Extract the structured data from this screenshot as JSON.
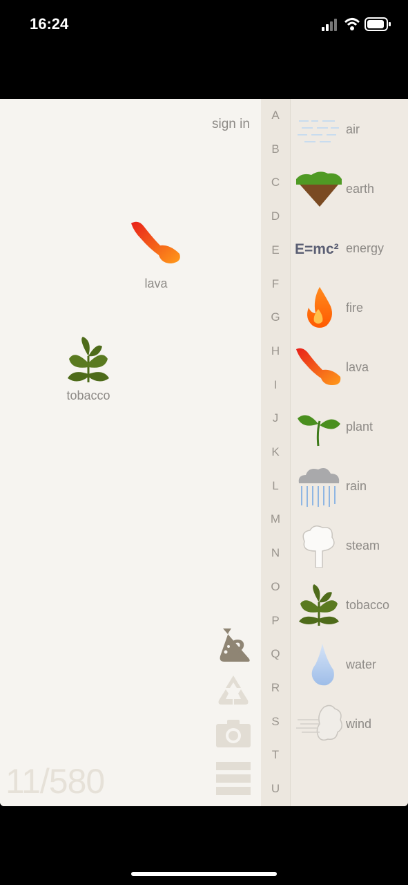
{
  "status": {
    "time": "16:24"
  },
  "workspace": {
    "sign_in": "sign in",
    "items": [
      {
        "label": "lava"
      },
      {
        "label": "tobacco"
      }
    ],
    "counter": "11/580"
  },
  "alphabet": [
    "A",
    "B",
    "C",
    "D",
    "E",
    "F",
    "G",
    "H",
    "I",
    "J",
    "K",
    "L",
    "M",
    "N",
    "O",
    "P",
    "Q",
    "R",
    "S",
    "T",
    "U"
  ],
  "elements": [
    {
      "name": "air",
      "icon": "air-icon"
    },
    {
      "name": "earth",
      "icon": "earth-icon"
    },
    {
      "name": "energy",
      "icon": "energy-icon",
      "icon_text": "E=mc²"
    },
    {
      "name": "fire",
      "icon": "fire-icon"
    },
    {
      "name": "lava",
      "icon": "lava-icon"
    },
    {
      "name": "plant",
      "icon": "plant-icon"
    },
    {
      "name": "rain",
      "icon": "rain-icon"
    },
    {
      "name": "steam",
      "icon": "steam-icon"
    },
    {
      "name": "tobacco",
      "icon": "tobacco-icon"
    },
    {
      "name": "water",
      "icon": "water-icon"
    },
    {
      "name": "wind",
      "icon": "wind-icon"
    }
  ],
  "tools": [
    "little-alchemy-2-icon",
    "recycle-icon",
    "camera-icon",
    "menu-icon"
  ],
  "colors": {
    "lava": "#ff5a1f",
    "fire": "#ff7a00",
    "plant": "#4a8f1e",
    "tobacco": "#4e6b1a",
    "water": "#a9c6ef",
    "label": "#8d8a86"
  }
}
